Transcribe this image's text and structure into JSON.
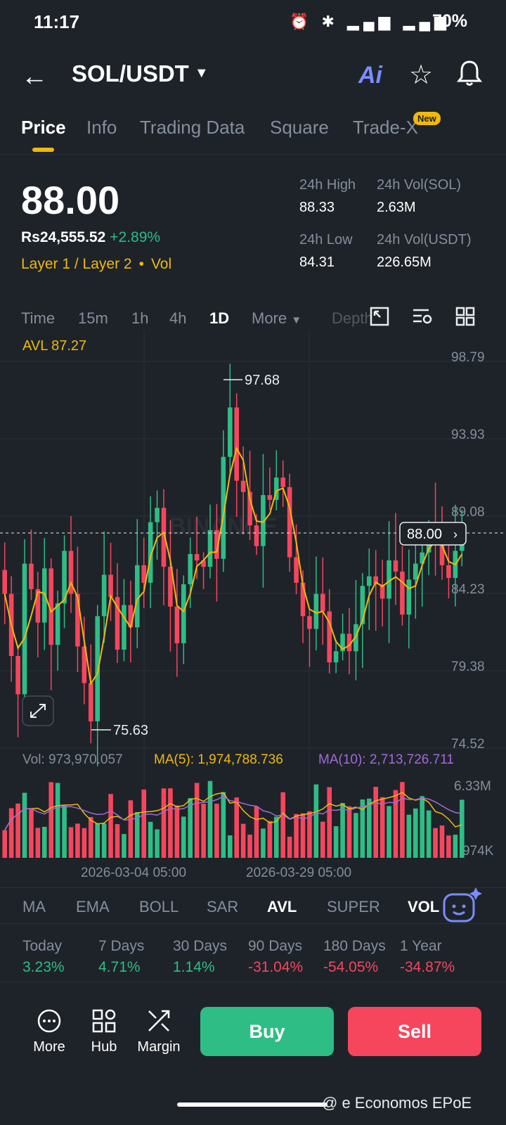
{
  "status": {
    "time": "11:17",
    "battery": "70%",
    "icons": "⏰ ✱ ▂▄▆ ▂▄▆"
  },
  "header": {
    "pair": "SOL/USDT",
    "ai_label": "Ai"
  },
  "tabs": [
    {
      "label": "Price",
      "active": true
    },
    {
      "label": "Info"
    },
    {
      "label": "Trading Data"
    },
    {
      "label": "Square"
    },
    {
      "label": "Trade-X"
    }
  ],
  "tab_badge": "New",
  "price": {
    "last": "88.00",
    "inr": "Rs24,555.52",
    "change": "+2.89%",
    "tag1": "Layer 1 / Layer 2",
    "tag2": "Vol"
  },
  "stats": {
    "high_label": "24h High",
    "high": "88.33",
    "vol_sol_label": "24h Vol(SOL)",
    "vol_sol": "2.63M",
    "low_label": "24h Low",
    "low": "84.31",
    "vol_usdt_label": "24h Vol(USDT)",
    "vol_usdt": "226.65M"
  },
  "timeframes": [
    "Time",
    "15m",
    "1h",
    "4h",
    "1D",
    "More",
    "Depth"
  ],
  "active_timeframe": "1D",
  "chart_data": {
    "type": "candlestick",
    "avl_label": "AVL 87.27",
    "price_axis": [
      "98.79",
      "93.93",
      "89.08",
      "84.23",
      "79.38",
      "74.52"
    ],
    "ylim": [
      74.52,
      98.79
    ],
    "current_price": "88.00",
    "max_label": "97.68",
    "min_label": "75.63",
    "watermark": "BINANCE",
    "closes": [
      84.2,
      80.3,
      77.9,
      86.1,
      84.5,
      82.4,
      85.8,
      81.0,
      83.6,
      86.9,
      84.2,
      80.9,
      78.6,
      76.2,
      82.8,
      85.4,
      84.0,
      80.7,
      83.5,
      82.1,
      86.0,
      84.9,
      88.7,
      89.6,
      85.9,
      83.4,
      81.1,
      84.8,
      86.7,
      86.3,
      85.9,
      88.2,
      86.4,
      92.8,
      95.9,
      91.3,
      90.6,
      88.5,
      87.2,
      90.4,
      90.1,
      91.5,
      90.9,
      86.5,
      84.9,
      82.8,
      82.0,
      84.2,
      83.1,
      79.9,
      80.6,
      81.7,
      80.6,
      82.3,
      84.7,
      85.3,
      84.8,
      83.9,
      86.3,
      85.6,
      82.9,
      85.1,
      86.1,
      86.8,
      88.2,
      87.5,
      86.0,
      85.2,
      86.9,
      88.0
    ],
    "ma_line_note": "yellow moving average overlay",
    "volume": {
      "label": "Vol: 973,970.057",
      "ma5": "MA(5): 1,974,788.736",
      "ma10": "MA(10): 2,713,726.711",
      "axis_top": "6.33M",
      "axis_bottom": "974K"
    },
    "x_labels": [
      "2026-03-04 05:00",
      "2026-03-29 05:00"
    ]
  },
  "indicators": [
    "MA",
    "EMA",
    "BOLL",
    "SAR",
    "AVL",
    "SUPER",
    "VOL"
  ],
  "active_indicator": "AVL",
  "performance": [
    {
      "label": "Today",
      "value": "3.23%",
      "up": true
    },
    {
      "label": "7 Days",
      "value": "4.71%",
      "up": true
    },
    {
      "label": "30 Days",
      "value": "1.14%",
      "up": true
    },
    {
      "label": "90 Days",
      "value": "-31.04%",
      "up": false
    },
    {
      "label": "180 Days",
      "value": "-54.05%",
      "up": false
    },
    {
      "label": "1 Year",
      "value": "-34.87%",
      "up": false
    }
  ],
  "bottom": {
    "more": "More",
    "hub": "Hub",
    "margin": "Margin",
    "buy": "Buy",
    "sell": "Sell"
  },
  "watermark": "@ e Economos EPoE",
  "colors": {
    "up": "#2ebd85",
    "down": "#f6465d",
    "accent": "#f0b90b",
    "ma10": "#a06bd6"
  }
}
